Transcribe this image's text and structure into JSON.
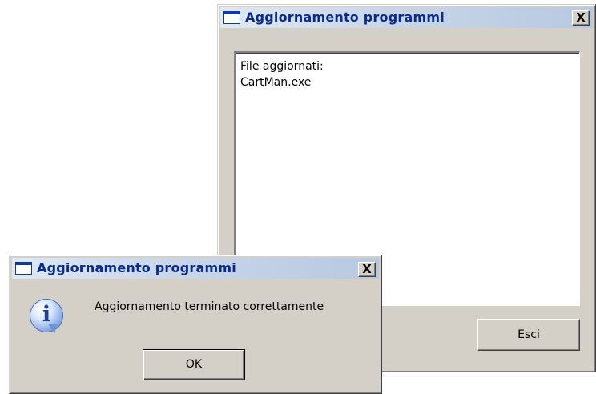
{
  "main_window": {
    "title": "Aggiornamento programmi",
    "close_label": "X",
    "file_list": {
      "lines": [
        "File aggiornati:",
        "CartMan.exe"
      ]
    },
    "exit_button": "Esci"
  },
  "message_box": {
    "title": "Aggiornamento programmi",
    "close_label": "X",
    "icon": "information-icon",
    "icon_glyph": "i",
    "message": "Aggiornamento terminato correttamente",
    "ok_button": "OK"
  },
  "colors": {
    "title_text": "#0a2b8c",
    "window_face": "#d4d0c8",
    "titlebar_gradient_start": "#dfe8f4",
    "titlebar_gradient_end": "#b7c9e1"
  }
}
